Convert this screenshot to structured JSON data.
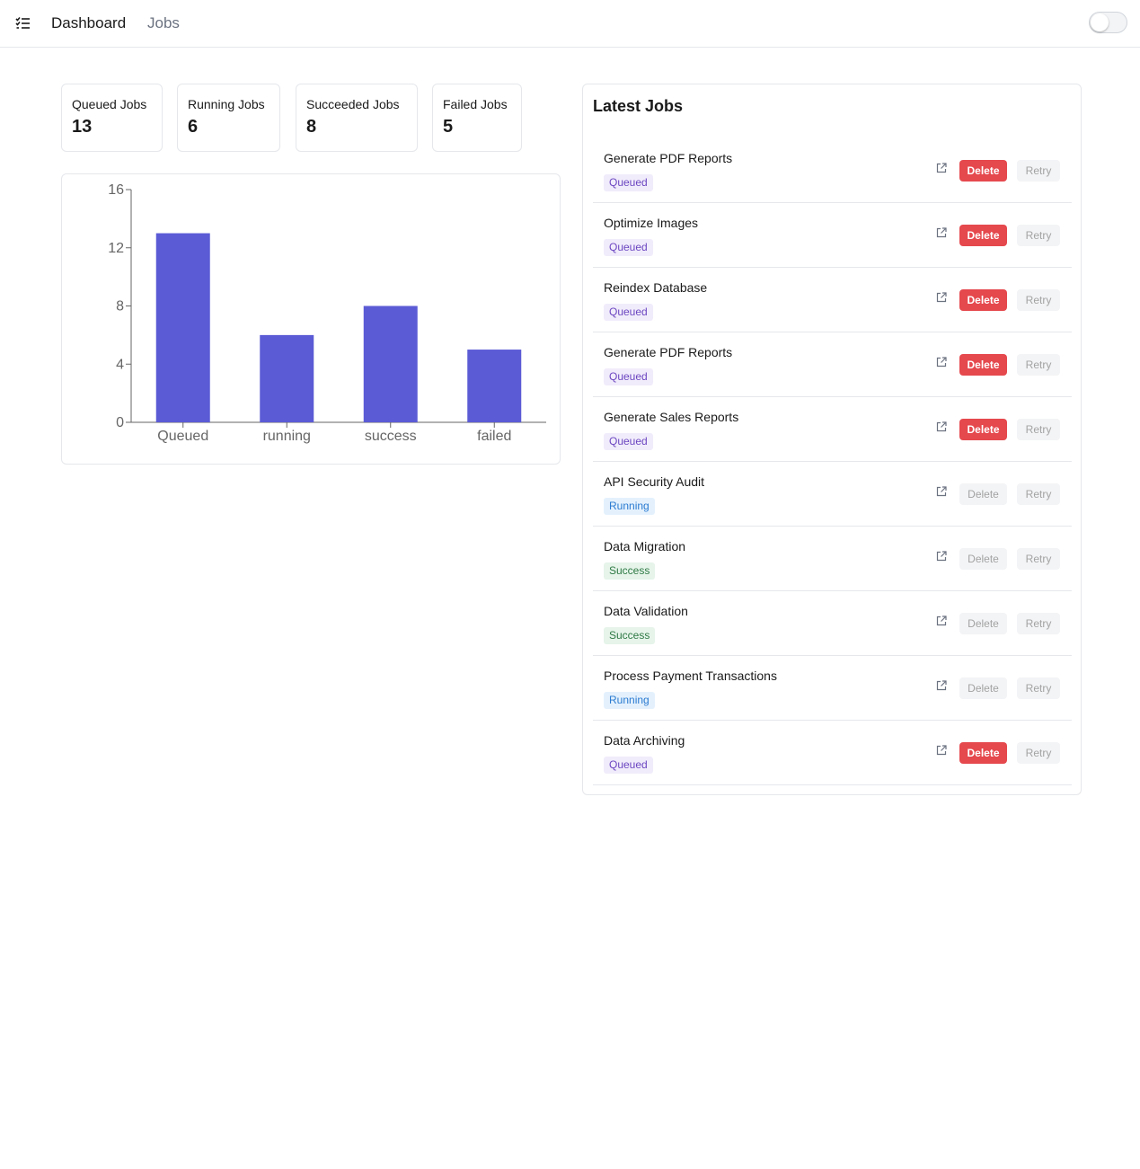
{
  "header": {
    "menu_icon": "checklist-menu-icon",
    "nav": [
      {
        "label": "Dashboard",
        "active": true
      },
      {
        "label": "Jobs",
        "active": false
      }
    ],
    "theme_toggle": {
      "icon": "toggle-switch",
      "on": false
    }
  },
  "stats": [
    {
      "label": "Queued Jobs",
      "value": "13"
    },
    {
      "label": "Running Jobs",
      "value": "6"
    },
    {
      "label": "Succeeded Jobs",
      "value": "8"
    },
    {
      "label": "Failed Jobs",
      "value": "5"
    }
  ],
  "chart_data": {
    "type": "bar",
    "categories": [
      "Queued",
      "running",
      "success",
      "failed"
    ],
    "values": [
      13,
      6,
      8,
      5
    ],
    "yticks": [
      0,
      4,
      8,
      12,
      16
    ],
    "ylim": [
      0,
      16
    ],
    "bar_color": "#5b5bd6",
    "grid": false,
    "legend": "none",
    "title": "",
    "xlabel": "",
    "ylabel": ""
  },
  "latest_jobs": {
    "title": "Latest Jobs",
    "delete_label": "Delete",
    "retry_label": "Retry",
    "items": [
      {
        "name": "Generate PDF Reports",
        "status": "Queued",
        "delete_enabled": true
      },
      {
        "name": "Optimize Images",
        "status": "Queued",
        "delete_enabled": true
      },
      {
        "name": "Reindex Database",
        "status": "Queued",
        "delete_enabled": true
      },
      {
        "name": "Generate PDF Reports",
        "status": "Queued",
        "delete_enabled": true
      },
      {
        "name": "Generate Sales Reports",
        "status": "Queued",
        "delete_enabled": true
      },
      {
        "name": "API Security Audit",
        "status": "Running",
        "delete_enabled": false
      },
      {
        "name": "Data Migration",
        "status": "Success",
        "delete_enabled": false
      },
      {
        "name": "Data Validation",
        "status": "Success",
        "delete_enabled": false
      },
      {
        "name": "Process Payment Transactions",
        "status": "Running",
        "delete_enabled": false
      },
      {
        "name": "Data Archiving",
        "status": "Queued",
        "delete_enabled": true
      }
    ]
  },
  "colors": {
    "delete_active": "#e5484d",
    "queued_badge": "#6b46c1",
    "running_badge": "#2b7bd1",
    "success_badge": "#2f7a45"
  }
}
